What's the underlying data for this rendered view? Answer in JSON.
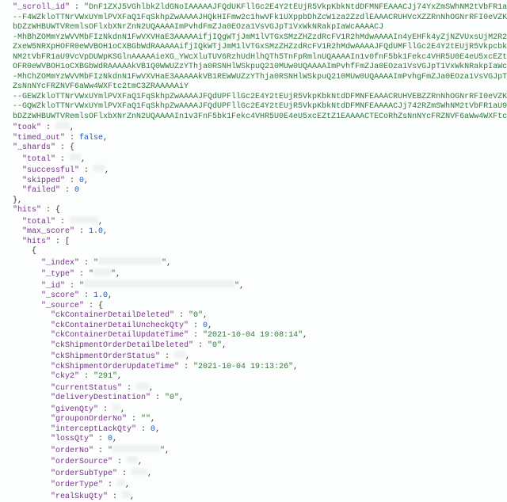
{
  "scroll_id_label": "_scroll_id",
  "scroll_id_lines": [
    "DnF1ZXJ5VGhlbkZldGNoIAAAAAJFQdUKFllGc2E4Y2tEUjR5VkpKbkNtdDFMNFEAAACJj74YxZmSWhNM2tVbFR1aU9VcVpDUWpKSGlnAAAAAiY",
    "--F4WZkloTTNrVWxUYmlPVXFaQ1FqSkhpZwAAAAJHQkHIFmw2c1hwVFk1UXppbDhZcW1za2ZzdlEAAACRUHVcXZZRnNhOGNrRFI0eVZKSm5DbXQxTDRRAAAAAkxAqEcW",
    "bDZzWHBUWTVRemlsOFlxbXNrZnN2UQAAAAImPvhdFmZJa0EOza1VsVGJpT1VxWkNRakpIaWcAAAACJ",
    "-MhBhZOMmYzWVVMbFIzNkdnN1FwVXVHaE3AAAAAifjIQgWTjJmM1lVTGxSMzZHZzdRcFV1R2hMdwAAAAIn4yEHFk4yZjNZVUxsUjM2R2c3UXBVdUdoR3cAAAACJ5db8x",
    "ZxeW5NRXpHOFR0eWVBOH1oCXBGbWdRAAAAAifjIQkWTjJmM1lVTGxSMzZHZzdRcFV1R2hMdwAAAAJFQdUMFllGc2E4Y2tEUjR5VkpcbkNtdDFMNFEAAACJj74YhZmSWh",
    "NM2tVbFR1aU9VcVpDUWpKSGlnAAAAAieXG_YWcXluTUV6RzhUdHlhQTh5TnFpRmlnUQAAAAIn1v0fnF5bk1Fekc4VHR5U0E4eU5xcEZtZ1EAAAACJ5db9RZxeW5NRXpH",
    "OFR0eWVBOH1oCXBGbWdRAAAAAkVB1Q0WWUZzYThja0RSNHlWSkpuQ210MUw0UQAAAAImPvhfFmZJa0EOza1VsVGJpT1VxWkNRakpIaWcAAAACJ",
    "-MhChZOMmYzWVVMbFIzNkdnN1FwVXVHaE3AAAAAkVB1REWWUZzYThja0RSNHlWSkpuQ210MUw0UQAAAAImPvhgFmZJa0EOza1VsVGJpT1VxWkNRakpIaWcAAAACTECoSh",
    "ZsNnNYcFRZNVF6aWw4WXFtc2tmC3ZRAAAAAiY",
    "--GEWZkloTTNrVWxUYmlPVXFaQ1FqSkhpZwAAAAJFQdUPFllGc2E4Y2tEUjR5VkpKbkNtdDFMNFEAAACRUHVEBZZRnNhOGNrRFI0eVZKSm5DbXQxTDRRAAAAAiY",
    "--GQWZkloTTNrVWxUYmlPVXFaQ1FqSkhpZwAAAAJFQdUPFllGc2E4Y2tEUjR5VkpKbkNtdDFMNFEAAAACJj742RZmSWhNM2tVbFR1aU9VcVpDUWpKSGlnAAAAAkxAqEkW",
    "bDZzWHBUWTVRemlsOFlxbXNrZnN2UQAAAAIn1v3FnF5bk1Fekc4VHR5U0E4eU5xcEZtZ1EAAAACTECoRhZsNnNYcFRZNVF6aWw4WXFtc2tmC3ZR"
  ],
  "took_label": "took",
  "timed_out_label": "timed_out",
  "timed_out": "false",
  "shards_label": "_shards",
  "shards": {
    "total_label": "total",
    "successful_label": "successful",
    "skipped_label": "skipped",
    "skipped": "0",
    "failed_label": "failed",
    "failed": "0"
  },
  "hits_label": "hits",
  "hits": {
    "total_label": "total",
    "max_score_label": "max_score",
    "max_score": "1.0",
    "hits_inner_label": "hits",
    "item": {
      "index_label": "_index",
      "type_label": "_type",
      "id_label": "_id",
      "score_label": "_score",
      "score": "1.0",
      "source_label": "_source",
      "source": {
        "ckContainerDetailDeleted_label": "ckContainerDetailDeleted",
        "ckContainerDetailDeleted": "0",
        "ckContainerDetailUncheckQty_label": "ckContainerDetailUncheckQty",
        "ckContainerDetailUncheckQty": "0",
        "ckContainerDetailUpdateTime_label": "ckContainerDetailUpdateTime",
        "ckContainerDetailUpdateTime": "2021-10-04 19:08:14",
        "ckShipmentOrderDetailDeleted_label": "ckShipmentOrderDetailDeleted",
        "ckShipmentOrderDetailDeleted": "0",
        "ckShipmentOrderStatus_label": "ckShipmentOrderStatus",
        "ckShipmentOrderUpdateTime_label": "ckShipmentOrderUpdateTime",
        "ckShipmentOrderUpdateTime": "2021-10-04 19:13:26",
        "cky2_label": "cky2",
        "cky2": "291",
        "currentStatus_label": "currentStatus",
        "deliveryDestination_label": "deliveryDestination",
        "deliveryDestination": "0",
        "givenQty_label": "givenQty",
        "grouponOrderNo_label": "grouponOrderNo",
        "grouponOrderNo": "",
        "interceptLackQty_label": "interceptLackQty",
        "interceptLackQty": "0",
        "lossQty_label": "lossQty",
        "lossQty": "0",
        "orderNo_label": "orderNo",
        "orderSource_label": "orderSource",
        "orderSubType_label": "orderSubType",
        "orderType_label": "orderType",
        "realSkuQty_label": "realSkuQty"
      }
    }
  }
}
